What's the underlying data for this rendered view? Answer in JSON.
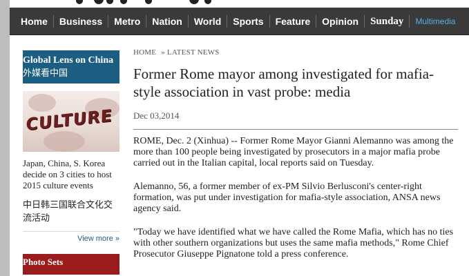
{
  "nav": {
    "items": [
      {
        "label": "Home"
      },
      {
        "label": "Business"
      },
      {
        "label": "Metro"
      },
      {
        "label": "Nation"
      },
      {
        "label": "World"
      },
      {
        "label": "Sports"
      },
      {
        "label": "Feature"
      },
      {
        "label": "Opinion"
      },
      {
        "label": "Sunday"
      },
      {
        "label": "Multimedia"
      }
    ]
  },
  "sidebar": {
    "global_lens": {
      "title": "Global Lens on China",
      "subtitle": "外媒看中国"
    },
    "image_word": "CULTURE",
    "headline": "Japan, China, S. Korea decide on 3 cities to host 2015 culture events",
    "headline_chinese": "中日韩三国联合文化交流活动",
    "view_more": "View more »",
    "photo_sets": {
      "title": "Photo Sets"
    }
  },
  "article": {
    "breadcrumb": {
      "home": "HOME",
      "separator": "»",
      "section": "LATEST NEWS"
    },
    "title": "Former Rome mayor among investigated for mafia-style association in vast probe: media",
    "date": "Dec 03,2014",
    "paragraphs": [
      "ROME, Dec. 2 (Xinhua) -- Former Rome Mayor Gianni Alemanno was among the more than 100 people being investigated by prosecutors in a major mafia probe carried out in the Italian capital, local reports said on Tuesday.",
      "Alemanno, 56, a former member of ex-PM Silvio Berlusconi's center-right formation, was put under investigation for mafia-style association, ANSA news agency said.",
      "\"Today we have identified what we have called the Rome Mafia, which has no ties with other southern organizations but uses the same mafia methods,\" Rome Chief Prosecutor Giuseppe Pignatone told a press conference."
    ]
  },
  "colors": {
    "nav_bg": "#3a3a3a",
    "lens_box": "#1c5d82",
    "photo_box": "#9b1c1c",
    "link": "#1a5b8c",
    "multimedia": "#5aaee8"
  }
}
